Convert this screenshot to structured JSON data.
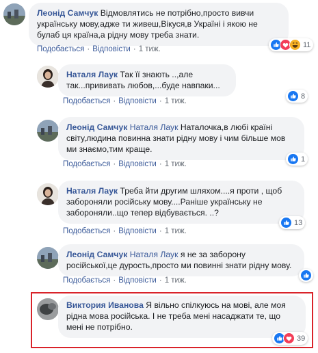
{
  "comments": [
    {
      "author": "Леонід Самчук",
      "mention": "",
      "text": "Відмовлятись не потрібно,просто вивчи українську мову,адже ти живеш,Вікуся,в Україні і якою не булаб ця країна,а рідну мову треба знати.",
      "actions": {
        "like": "Подобається",
        "reply": "Відповісти",
        "time": "1 тиж."
      },
      "reactions": {
        "icons": [
          "like-icon",
          "love-icon",
          "haha-icon"
        ],
        "count": "11"
      }
    },
    {
      "author": "Наталя Лаук",
      "mention": "",
      "text": "Так її знають ..,але так...прививать любов,...буде навпаки...",
      "actions": {
        "like": "Подобається",
        "reply": "Відповісти",
        "time": "1 тиж."
      },
      "reactions": {
        "icons": [
          "like-icon"
        ],
        "count": "8"
      }
    },
    {
      "author": "Леонід Самчук",
      "mention": "Наталя Лаук",
      "text": "Наталочка,в любі країні світу,людина повинна знати рідну мову і чим більше мов ми знаємо,тим краще.",
      "actions": {
        "like": "Подобається",
        "reply": "Відповісти",
        "time": "1 тиж."
      },
      "reactions": {
        "icons": [
          "like-icon"
        ],
        "count": "1"
      }
    },
    {
      "author": "Наталя Лаук",
      "mention": "",
      "text": "Треба йти другим шляхом....я проти , щоб забороняли російську мову....Раніше українську не забороняли..що тепер відбувається. ..?",
      "actions": {
        "like": "Подобається",
        "reply": "Відповісти",
        "time": "1 тиж."
      },
      "reactions": {
        "icons": [
          "like-icon"
        ],
        "count": "13"
      }
    },
    {
      "author": "Леонід Самчук",
      "mention": "Наталя Лаук",
      "text": "я не за заборону російської,це дурость,просто ми повинні знати рідну мову.",
      "actions": {
        "like": "Подобається",
        "reply": "Відповісти",
        "time": "1 тиж."
      },
      "reactions": {
        "icons": [
          "like-icon"
        ],
        "count": ""
      }
    },
    {
      "author": "Виктория Иванова",
      "mention": "",
      "text": "Я вільно спілкуюсь на мові, але моя рідна мова російська. І не треба мені насаджати те, що мені не потрібно.",
      "actions": {
        "like": "",
        "reply": "",
        "time": ""
      },
      "reactions": {
        "icons": [
          "like-icon",
          "love-icon"
        ],
        "count": "39"
      }
    }
  ],
  "colors": {
    "link": "#385898",
    "bubble": "#f2f3f5",
    "like": "#1877f2",
    "love": "#f33e58",
    "haha": "#f7b125",
    "highlight": "#d9232a"
  }
}
